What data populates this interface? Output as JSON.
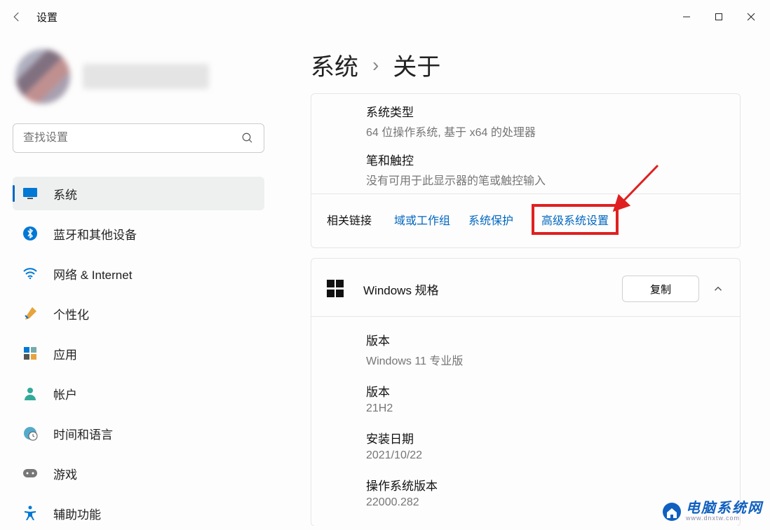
{
  "titlebar": {
    "app_title": "设置"
  },
  "search": {
    "placeholder": "查找设置"
  },
  "sidebar": {
    "items": [
      {
        "label": "系统"
      },
      {
        "label": "蓝牙和其他设备"
      },
      {
        "label": "网络 & Internet"
      },
      {
        "label": "个性化"
      },
      {
        "label": "应用"
      },
      {
        "label": "帐户"
      },
      {
        "label": "时间和语言"
      },
      {
        "label": "游戏"
      },
      {
        "label": "辅助功能"
      }
    ]
  },
  "breadcrumb": {
    "parent": "系统",
    "current": "关于"
  },
  "device_specs": {
    "system_type_label": "系统类型",
    "system_type_value": "64 位操作系统, 基于 x64 的处理器",
    "pen_touch_label": "笔和触控",
    "pen_touch_value": "没有可用于此显示器的笔或触控输入"
  },
  "related": {
    "title": "相关链接",
    "link_domain": "域或工作组",
    "link_protect": "系统保护",
    "link_advanced": "高级系统设置"
  },
  "windows_specs": {
    "section_title": "Windows 规格",
    "copy_label": "复制",
    "edition_label": "版本",
    "edition_value": "Windows 11 专业版",
    "version_label": "版本",
    "version_value": "21H2",
    "install_date_label": "安装日期",
    "install_date_value": "2021/10/22",
    "os_build_label": "操作系统版本",
    "os_build_value": "22000.282"
  },
  "watermark": {
    "cn": "电脑系统网",
    "en": "www.dnxtw.com"
  }
}
